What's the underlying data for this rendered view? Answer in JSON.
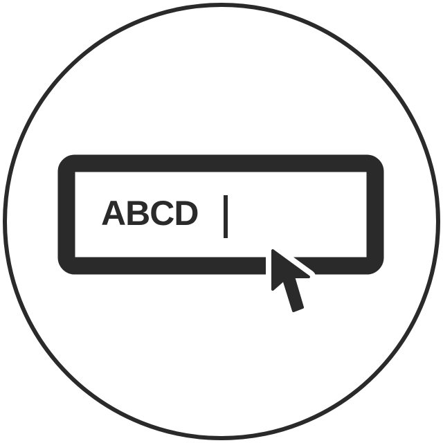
{
  "icon": {
    "name": "text-input-icon",
    "stroke_color": "#2a2a2a",
    "background_color": "#ffffff"
  },
  "input_field": {
    "value": "ABCD"
  },
  "cursor": {
    "name": "mouse-pointer-icon"
  }
}
